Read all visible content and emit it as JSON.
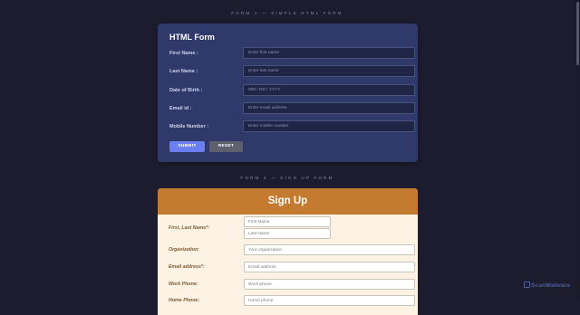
{
  "section1_label": "FORM 1 — SIMPLE HTML FORM",
  "section2_label": "FORM 2 — SIGN UP FORM",
  "form1": {
    "title": "HTML Form",
    "fields": [
      {
        "label": "First Name :",
        "placeholder": "Enter first name"
      },
      {
        "label": "Last Name :",
        "placeholder": "Enter last name"
      },
      {
        "label": "Date of Birth :",
        "placeholder": "MM / DD / YYYY"
      },
      {
        "label": "Email id :",
        "placeholder": "Enter email address"
      },
      {
        "label": "Mobile Number :",
        "placeholder": "Enter mobile number"
      }
    ],
    "submit_label": "SUBMIT",
    "reset_label": "RESET"
  },
  "form2": {
    "title": "Sign Up",
    "name_label": "First, Last Name*:",
    "first_placeholder": "First Name",
    "last_placeholder": "Last Name",
    "org_label": "Organization:",
    "org_placeholder": "Your organization",
    "email_label": "Email address*:",
    "email_placeholder": "Email address",
    "work_label": "Work Phone:",
    "work_placeholder": "Work phone",
    "home_label": "Home Phone:",
    "home_placeholder": "Home phone"
  },
  "watermark": "ScanMalware",
  "colors": {
    "background": "#1d1c2e",
    "form1_card": "#2f3a6b",
    "submit": "#6b7ff0",
    "reset": "#5e6070",
    "form2_header": "#c47a2f",
    "form2_body": "#fcf3e4"
  }
}
